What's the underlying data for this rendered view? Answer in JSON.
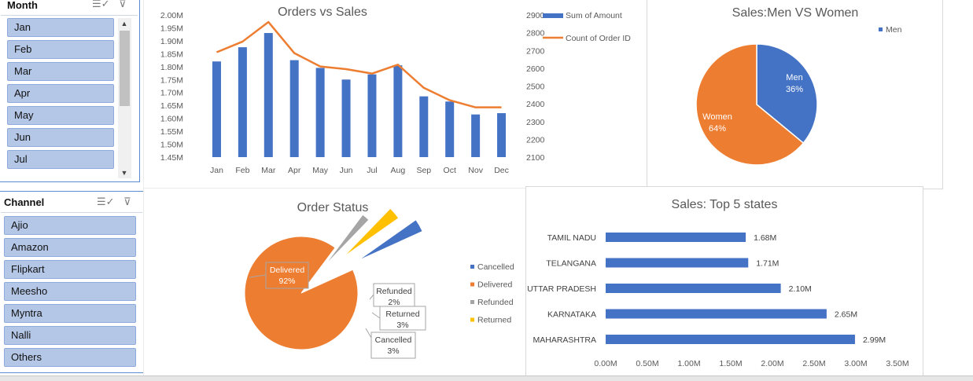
{
  "slicers": {
    "month": {
      "title": "Month",
      "items": [
        "Jan",
        "Feb",
        "Mar",
        "Apr",
        "May",
        "Jun",
        "Jul"
      ]
    },
    "channel": {
      "title": "Channel",
      "items": [
        "Ajio",
        "Amazon",
        "Flipkart",
        "Meesho",
        "Myntra",
        "Nalli",
        "Others"
      ]
    }
  },
  "icons": {
    "multi_select": "multi-select-icon",
    "clear_filter": "clear-filter-icon"
  },
  "colors": {
    "blue": "#4472c4",
    "orange": "#ed7d31",
    "gray": "#a5a5a5",
    "yellow": "#ffc000",
    "slicer_item": "#b4c7e7"
  },
  "chart_data": [
    {
      "id": "orders_vs_sales",
      "type": "bar",
      "title": "Orders vs Sales",
      "categories": [
        "Jan",
        "Feb",
        "Mar",
        "Apr",
        "May",
        "Jun",
        "Jul",
        "Aug",
        "Sep",
        "Oct",
        "Nov",
        "Dec"
      ],
      "series": [
        {
          "name": "Sum of Amount",
          "type": "bar",
          "axis": "left",
          "values": [
            1820000,
            1875000,
            1930000,
            1825000,
            1795000,
            1750000,
            1770000,
            1805000,
            1685000,
            1665000,
            1615000,
            1620000
          ]
        },
        {
          "name": "Count of Order ID",
          "type": "line",
          "axis": "right",
          "values": [
            2690,
            2750,
            2860,
            2685,
            2610,
            2595,
            2570,
            2620,
            2490,
            2420,
            2380,
            2380
          ]
        }
      ],
      "y_left": {
        "min": 1450000,
        "max": 2000000,
        "step": 50000,
        "ticks": [
          "1.45M",
          "1.50M",
          "1.55M",
          "1.60M",
          "1.65M",
          "1.70M",
          "1.75M",
          "1.80M",
          "1.85M",
          "1.90M",
          "1.95M",
          "2.00M"
        ]
      },
      "y_right": {
        "min": 2100,
        "max": 2900,
        "step": 100,
        "ticks": [
          "2100",
          "2200",
          "2300",
          "2400",
          "2500",
          "2600",
          "2700",
          "2800",
          "2900"
        ]
      },
      "legend": [
        "Sum of Amount",
        "Count of Order ID"
      ],
      "legend_position": "top-right",
      "grid": false
    },
    {
      "id": "men_vs_women",
      "type": "pie",
      "title": "Sales:Men VS Women",
      "labels": [
        "Men",
        "Women"
      ],
      "values": [
        36,
        64
      ],
      "data_labels": [
        "36%",
        "64%"
      ],
      "legend": [
        "Men"
      ],
      "legend_position": "top-right"
    },
    {
      "id": "order_status",
      "type": "pie",
      "title": "Order Status",
      "labels": [
        "Delivered",
        "Refunded",
        "Returned",
        "Cancelled"
      ],
      "values": [
        92,
        2,
        3,
        3
      ],
      "data_labels": [
        "92%",
        "2%",
        "3%",
        "3%"
      ],
      "legend": [
        "Cancelled",
        "Delivered",
        "Refunded",
        "Returned"
      ],
      "legend_position": "right"
    },
    {
      "id": "top5_states",
      "type": "bar",
      "orientation": "horizontal",
      "title": "Sales: Top 5 states",
      "categories": [
        "TAMIL NADU",
        "TELANGANA",
        "UTTAR PRADESH",
        "KARNATAKA",
        "MAHARASHTRA"
      ],
      "values": [
        1680000,
        1710000,
        2100000,
        2650000,
        2990000
      ],
      "data_labels": [
        "1.68M",
        "1.71M",
        "2.10M",
        "2.65M",
        "2.99M"
      ],
      "x_axis": {
        "min": 0,
        "max": 3500000,
        "step": 500000,
        "ticks": [
          "0.00M",
          "0.50M",
          "1.00M",
          "1.50M",
          "2.00M",
          "2.50M",
          "3.00M",
          "3.50M"
        ]
      },
      "grid": false
    }
  ]
}
